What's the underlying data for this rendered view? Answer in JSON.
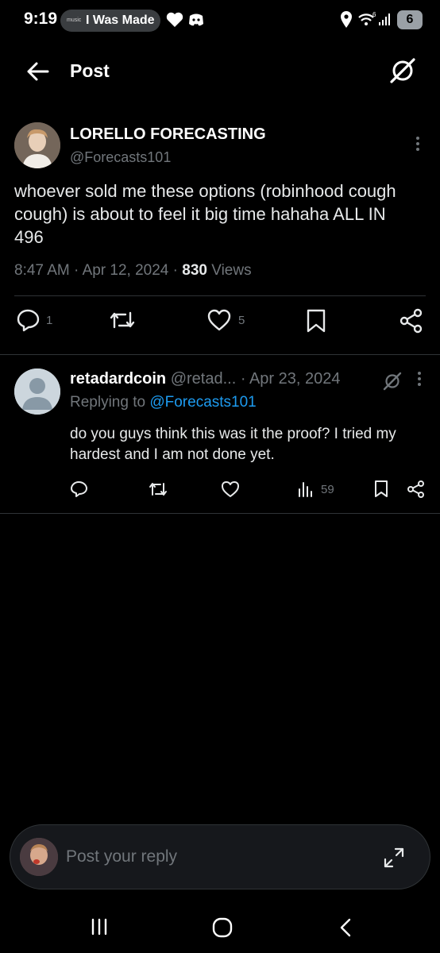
{
  "status_bar": {
    "time": "9:19",
    "music_tag": "music",
    "music_title": "I Was Made",
    "battery": "6"
  },
  "header": {
    "title": "Post"
  },
  "post": {
    "display_name": "LORELLO FORECASTING",
    "handle": "@Forecasts101",
    "text": "whoever sold me these options (robinhood cough cough) is about to feel it big time hahaha ALL IN 496",
    "time": "8:47 AM",
    "date": "Apr 12, 2024",
    "views_count": "830",
    "views_label": "Views",
    "reply_count": "1",
    "like_count": "5"
  },
  "reply": {
    "display_name": "retadardcoin",
    "handle": "@retad...",
    "date": "Apr 23, 2024",
    "replying_label": "Replying to",
    "replying_to": "@Forecasts101",
    "text": "do you guys think this was it the proof? I tried my hardest and I am not done yet.",
    "views_count": "59"
  },
  "compose": {
    "placeholder": "Post your reply"
  },
  "colors": {
    "background": "#000000",
    "text": "#e7e9ea",
    "muted": "#71767b",
    "link": "#1d9bf0",
    "divider": "#2f3336"
  }
}
